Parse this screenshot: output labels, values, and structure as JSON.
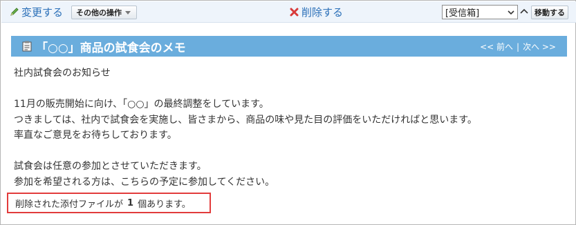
{
  "toolbar": {
    "edit_label": "変更する",
    "other_actions_label": "その他の操作",
    "delete_label": "削除する",
    "folder_select": {
      "selected": "[受信箱]",
      "options": [
        "[受信箱]"
      ]
    },
    "move_label": "移動する"
  },
  "memo": {
    "title": "「○○」商品の試食会のメモ",
    "nav": {
      "prev": "<< 前へ",
      "separator": "|",
      "next": "次へ >>"
    },
    "body_lines": [
      "社内試食会のお知らせ",
      "",
      "11月の販売開始に向け、「○○」の最終調整をしています。",
      "つきましては、社内で試食会を実施し、皆さまから、商品の味や見た目の評価をいただければと思います。",
      "率直なご意見をお待ちしております。",
      "",
      "試食会は任意の参加とさせていただきます。",
      "参加を希望される方は、こちらの予定に参加してください。"
    ]
  },
  "attachment_notice": {
    "prefix": "削除された添付ファイルが",
    "count": "1",
    "suffix": "個あります。"
  },
  "colors": {
    "toolbar_bg": "#eef4fb",
    "link_blue": "#2a6fb8",
    "title_bar": "#6aaddd",
    "delete_red": "#d83a3a",
    "edit_green": "#4a9a3a",
    "notice_border": "#e23b3b"
  },
  "icons": {
    "edit": "pencil-icon",
    "delete": "x-icon",
    "memo": "memo-icon",
    "move": "arrow-icon"
  }
}
